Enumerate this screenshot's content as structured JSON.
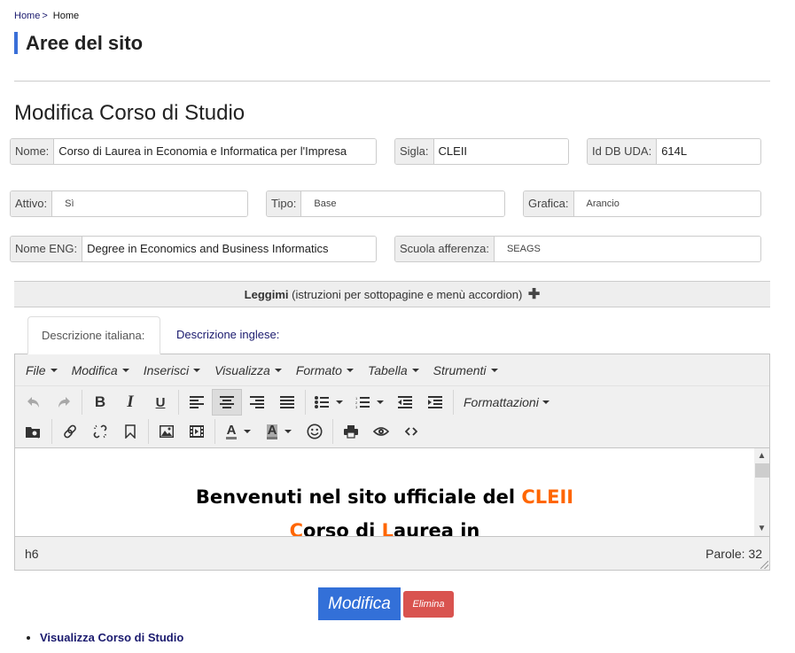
{
  "breadcrumb": {
    "items": [
      "Home",
      "Home"
    ],
    "separator": ">"
  },
  "area_title": "Aree del sito",
  "page_title": "Modifica Corso di Studio",
  "fields": {
    "nome": {
      "label": "Nome:",
      "value": "Corso di Laurea in Economia e Informatica per l'Impresa"
    },
    "sigla": {
      "label": "Sigla:",
      "value": "CLEII"
    },
    "id_db_uda": {
      "label": "Id DB UDA:",
      "value": "614L"
    },
    "attivo": {
      "label": "Attivo:",
      "value": "Sì"
    },
    "tipo": {
      "label": "Tipo:",
      "value": "Base"
    },
    "grafica": {
      "label": "Grafica:",
      "value": "Arancio"
    },
    "nome_eng": {
      "label": "Nome ENG:",
      "value": "Degree in Economics and Business Informatics"
    },
    "scuola_afferenza": {
      "label": "Scuola afferenza:",
      "value": "SEAGS"
    }
  },
  "leggimi": {
    "title": "Leggimi",
    "subtitle": " (istruzioni per sottopagine e menù accordion)",
    "icon": "plus-icon"
  },
  "tabs": [
    {
      "label": "Descrizione italiana:",
      "active": true
    },
    {
      "label": "Descrizione inglese:",
      "active": false
    }
  ],
  "editor": {
    "menu": [
      "File",
      "Modifica",
      "Inserisci",
      "Visualizza",
      "Formato",
      "Tabella",
      "Strumenti"
    ],
    "formats_label": "Formattazioni",
    "content": {
      "line1_prefix": "Benvenuti nel sito ufficiale del ",
      "line1_highlight": "CLEII",
      "line2_c": "C",
      "line2_a": "orso di ",
      "line2_l": "L",
      "line2_b": "aurea in"
    },
    "status_path": "h6",
    "word_count": "Parole: 32",
    "highlight_color": "#ff6600"
  },
  "buttons": {
    "modifica": "Modifica",
    "elimina": "Elimina"
  },
  "links": [
    {
      "label": "Visualizza Corso di Studio"
    }
  ],
  "colors": {
    "primary": "#3370d8",
    "danger": "#d9534f",
    "accent_bar": "#3a6fd8"
  }
}
